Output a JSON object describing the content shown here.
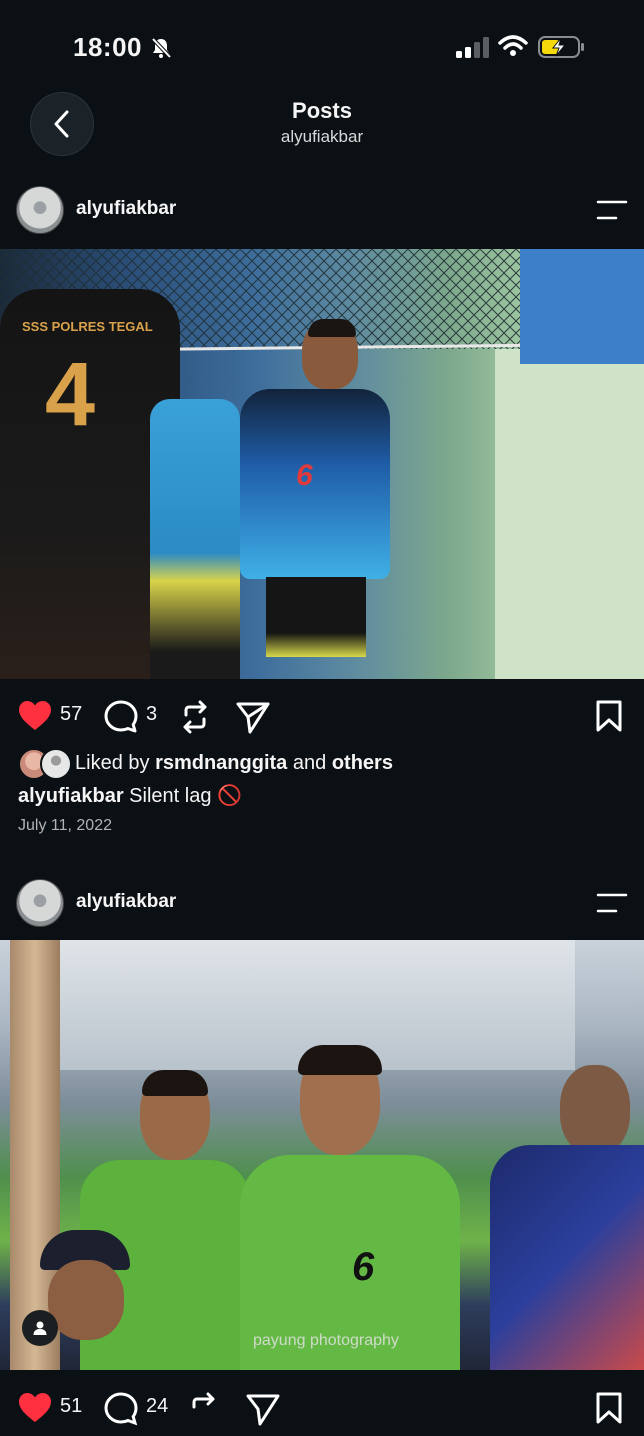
{
  "status": {
    "time": "18:00"
  },
  "header": {
    "title": "Posts",
    "subtitle": "alyufiakbar"
  },
  "posts": [
    {
      "username": "alyufiakbar",
      "likes": "57",
      "comments": "3",
      "liked_by_prefix": "Liked by",
      "liked_by_user": "rsmdnanggita",
      "liked_by_and": "and",
      "liked_by_others": "others",
      "caption_user": "alyufiakbar",
      "caption_text": "Silent lag 🚫",
      "date": "July 11, 2022",
      "photo_texts": {
        "jersey_team": "SSS POLRES TEGAL",
        "jersey_number": "4",
        "player_number": "6"
      }
    },
    {
      "username": "alyufiakbar",
      "photo_texts": {
        "jersey_number": "6",
        "watermark": "payung photography"
      },
      "likes": "51",
      "comments": "24"
    }
  ],
  "colors": {
    "like": "#ff3040",
    "bg": "#0b1014",
    "battery": "#f5d90a"
  }
}
